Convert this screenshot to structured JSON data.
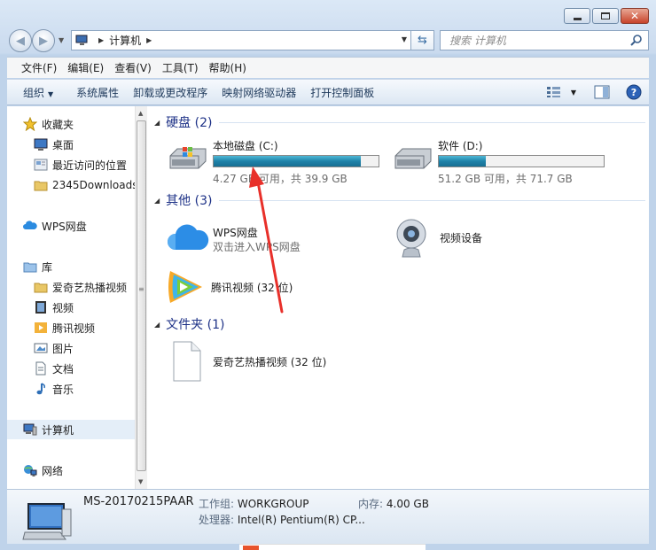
{
  "address": {
    "crumb": "计算机"
  },
  "search": {
    "placeholder": "搜索 计算机"
  },
  "menu": [
    "文件(F)",
    "编辑(E)",
    "查看(V)",
    "工具(T)",
    "帮助(H)"
  ],
  "commands": {
    "organize": "组织",
    "system_props": "系统属性",
    "uninstall": "卸载或更改程序",
    "map_drive": "映射网络驱动器",
    "control_panel": "打开控制面板"
  },
  "sidebar": {
    "items": [
      {
        "label": "收藏夹",
        "icon": "star-icon"
      },
      {
        "label": "桌面",
        "icon": "desktop-icon"
      },
      {
        "label": "最近访问的位置",
        "icon": "recent-places-icon"
      },
      {
        "label": "2345Downloads",
        "icon": "folder-icon"
      },
      {
        "label": "WPS网盘",
        "icon": "cloud-icon"
      },
      {
        "label": "库",
        "icon": "library-icon"
      },
      {
        "label": "爱奇艺热播视频",
        "icon": "folder-icon"
      },
      {
        "label": "视频",
        "icon": "video-icon"
      },
      {
        "label": "腾讯视频",
        "icon": "tencent-video-icon"
      },
      {
        "label": "图片",
        "icon": "pictures-icon"
      },
      {
        "label": "文档",
        "icon": "documents-icon"
      },
      {
        "label": "音乐",
        "icon": "music-icon"
      },
      {
        "label": "计算机",
        "icon": "computer-icon"
      },
      {
        "label": "网络",
        "icon": "network-icon"
      }
    ]
  },
  "groups": {
    "hdd": "硬盘 (2)",
    "other": "其他 (3)",
    "folders": "文件夹 (1)"
  },
  "drives": [
    {
      "name": "本地磁盘 (C:)",
      "free": "4.27 GB 可用，共 39.9 GB",
      "used_fraction": 0.893
    },
    {
      "name": "软件 (D:)",
      "free": "51.2 GB 可用，共 71.7 GB",
      "used_fraction": 0.286
    }
  ],
  "other": [
    {
      "name": "WPS网盘",
      "sub": "双击进入WPS网盘"
    },
    {
      "name": "视频设备",
      "sub": ""
    },
    {
      "name": "腾讯视频 (32 位)",
      "sub": ""
    }
  ],
  "folders": [
    {
      "name": "爱奇艺热播视频 (32 位)"
    }
  ],
  "details": {
    "pc_name": "MS-20170215PAAR",
    "workgroup_label": "工作组:",
    "workgroup": "WORKGROUP",
    "memory_label": "内存:",
    "memory": "4.00 GB",
    "cpu_label": "处理器:",
    "cpu": "Intel(R) Pentium(R) CP..."
  },
  "colors": {
    "accent": "#1e3287",
    "bar_fill": "#1f82a9",
    "annotation": "#e8302a"
  }
}
